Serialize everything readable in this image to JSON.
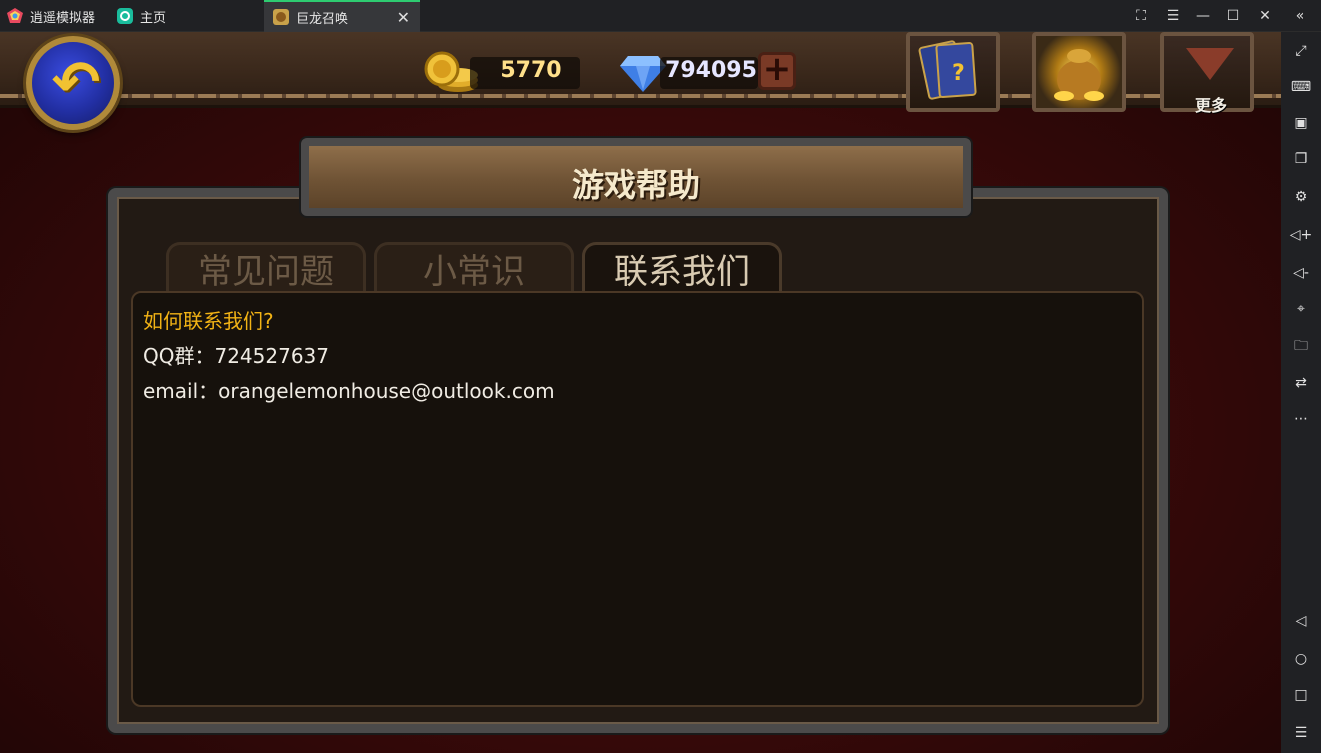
{
  "titlebar": {
    "app_name": "逍遥模拟器",
    "tabs": [
      {
        "label": "主页"
      },
      {
        "label": "巨龙召唤"
      }
    ]
  },
  "game": {
    "currency": {
      "gold": "5770",
      "gems": "794095"
    },
    "topbar": {
      "more_label": "更多"
    },
    "panel": {
      "title": "游戏帮助",
      "tabs": [
        {
          "label": "常见问题",
          "active": false
        },
        {
          "label": "小常识",
          "active": false
        },
        {
          "label": "联系我们",
          "active": true
        }
      ],
      "content": {
        "heading": "如何联系我们?",
        "lines": [
          "QQ群：724527637",
          "email：orangelemonhouse@outlook.com"
        ]
      }
    }
  },
  "colors": {
    "accent_tab": "#2ecc71",
    "heading_gold": "#f2b315"
  }
}
